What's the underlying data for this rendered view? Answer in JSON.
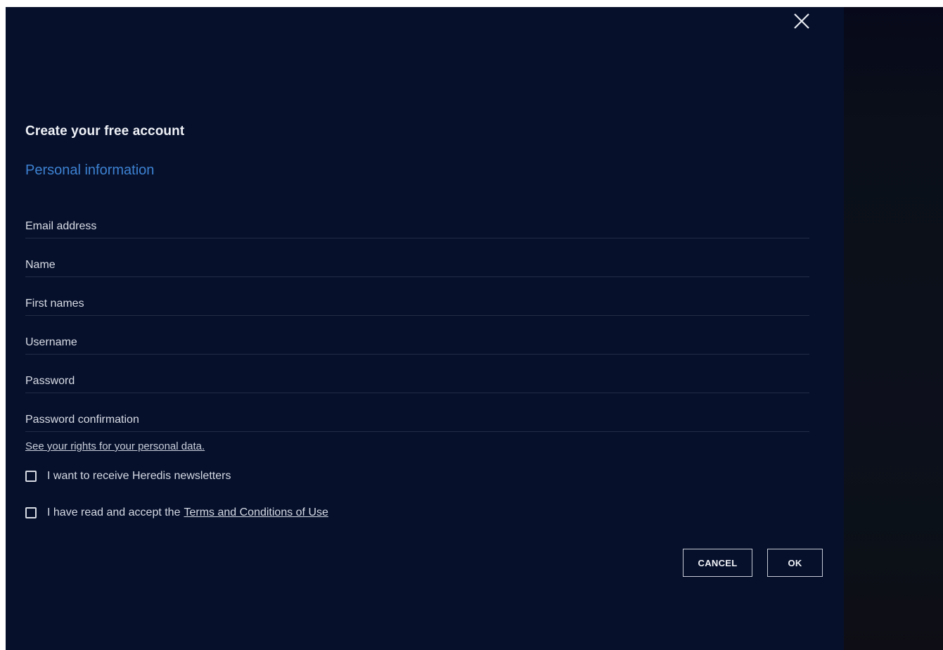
{
  "dialog": {
    "title": "Create your free account",
    "section_title": "Personal information",
    "close_icon": "close-icon"
  },
  "fields": {
    "email": {
      "placeholder": "Email address",
      "value": ""
    },
    "name": {
      "placeholder": "Name",
      "value": ""
    },
    "first_names": {
      "placeholder": "First names",
      "value": ""
    },
    "username": {
      "placeholder": "Username",
      "value": ""
    },
    "password": {
      "placeholder": "Password",
      "value": ""
    },
    "password_confirmation": {
      "placeholder": "Password confirmation",
      "value": ""
    }
  },
  "rights_link": "See your rights for your personal data.",
  "checkboxes": {
    "newsletter": {
      "label": "I want to receive Heredis newsletters",
      "checked": false
    },
    "terms": {
      "label_prefix": "I have read and accept the",
      "link": "Terms and Conditions of Use",
      "checked": false
    }
  },
  "buttons": {
    "cancel": "CANCEL",
    "ok": "OK"
  },
  "colors": {
    "panel_background": "#06102b",
    "accent": "#3d82d2",
    "text": "#e4e8ef"
  }
}
